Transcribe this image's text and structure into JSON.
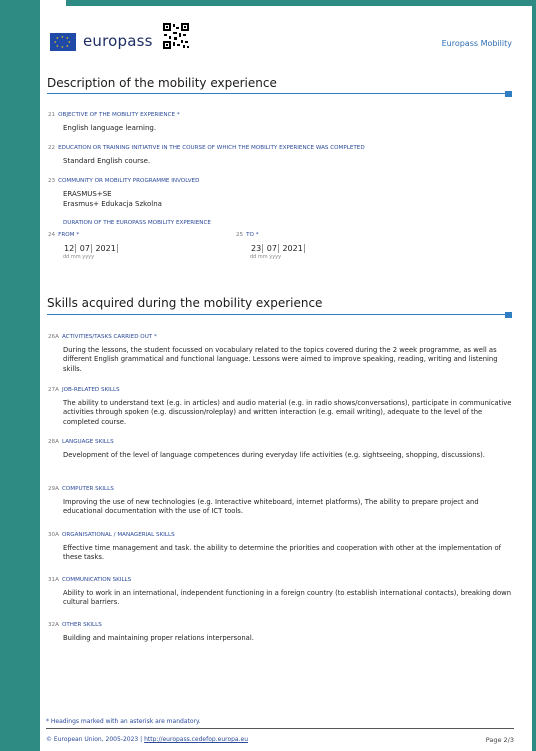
{
  "header": {
    "brand": "europass",
    "right_link": "Europass Mobility"
  },
  "section1": {
    "title": "Description of the mobility experience",
    "f21": {
      "num": "21",
      "label": "OBJECTIVE OF THE MOBILITY EXPERIENCE *",
      "value": "English language learning."
    },
    "f22": {
      "num": "22",
      "label": "EDUCATION OR TRAINING INITIATIVE IN THE COURSE OF WHICH THE MOBILITY EXPERIENCE WAS COMPLETED",
      "value": "Standard English course."
    },
    "f23": {
      "num": "23",
      "label": "COMMUNITY OR MOBILITY PROGRAMME INVOLVED",
      "value1": "ERASMUS+SE",
      "value2": "Erasmus+ Edukacja Szkolna"
    },
    "duration_label": "DURATION OF THE EUROPASS MOBILITY EXPERIENCE",
    "from": {
      "num": "24",
      "label": "FROM *",
      "dd": "12",
      "mm": "07",
      "yyyy": "2021",
      "sub": "dd mm yyyy"
    },
    "to": {
      "num": "25",
      "label": "TO *",
      "dd": "23",
      "mm": "07",
      "yyyy": "2021",
      "sub": "dd mm yyyy"
    }
  },
  "section2": {
    "title": "Skills acquired during the mobility experience",
    "items": [
      {
        "num": "26A",
        "label": "ACTIVITIES/TASKS CARRIED OUT *",
        "text": "During the lessons, the student focussed on vocabulary related to the topics covered during the 2 week programme, as well as different English grammatical and functional language. Lessons were aimed to improve speaking, reading, writing and listening skills."
      },
      {
        "num": "27A",
        "label": "JOB-RELATED SKILLS",
        "text": "The ability to understand text (e.g. in articles) and audio material (e.g. in radio shows/conversations), participate in communicative activities through spoken (e.g. discussion/roleplay) and written interaction (e.g. email writing), adequate to the level of the completed course."
      },
      {
        "num": "28A",
        "label": "LANGUAGE SKILLS",
        "text": "Development of the level of language competences during everyday life activities (e.g. sightseeing, shopping, discussions)."
      },
      {
        "num": "29A",
        "label": "COMPUTER SKILLS",
        "text": "Improving the use of new technologies (e.g. Interactive whiteboard, internet platforms), The ability to prepare project and educational documentation with the use of ICT tools."
      },
      {
        "num": "30A",
        "label": "ORGANISATIONAL / MANAGERIAL SKILLS",
        "text": "Effective time management and task. the ability to determine the priorities and cooperation with other at the implementation of these tasks."
      },
      {
        "num": "31A",
        "label": "COMMUNICATION SKILLS",
        "text": "Ability to work in an international, independent functioning in a foreign country (to establish international contacts), breaking down cultural barriers."
      },
      {
        "num": "32A",
        "label": "OTHER SKILLS",
        "text": "Building and maintaining proper relations interpersonal."
      }
    ]
  },
  "footer": {
    "note": "* Headings marked with an asterisk are mandatory.",
    "copyright": "© European Union, 2005-2023 |",
    "link": "http://europass.cedefop.europa.eu",
    "page": "Page 2/3"
  },
  "colors": {
    "background": "#2e8b84",
    "accent": "#2f7dc2",
    "label": "#2b4a9a"
  }
}
